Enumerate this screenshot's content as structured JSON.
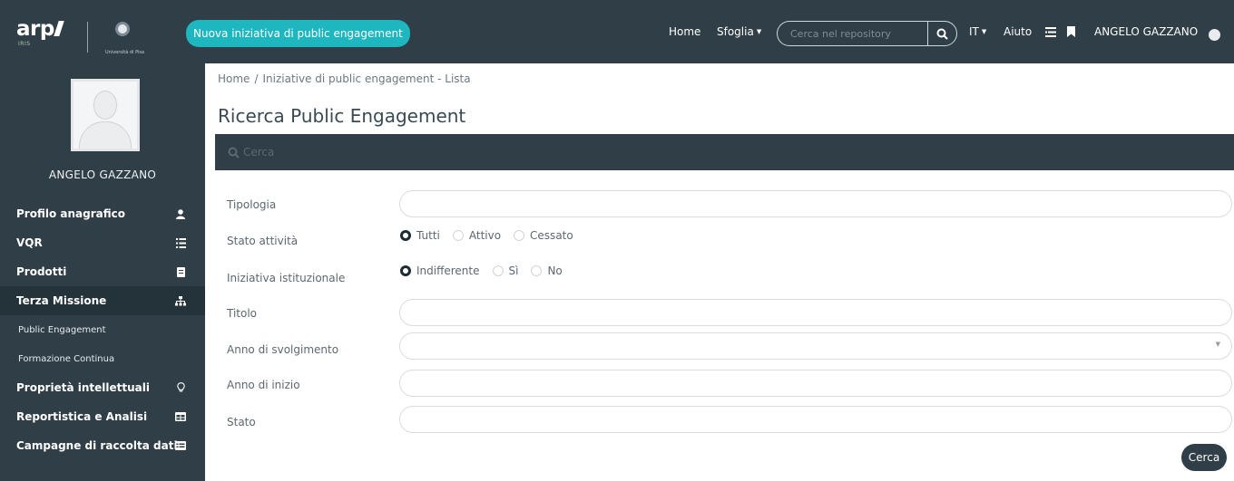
{
  "header": {
    "logo_text": "arp",
    "logo_sub": "IRIS",
    "university_name": "Università di Pisa",
    "new_initiative_label": "Nuova iniziativa di public engagement",
    "home_label": "Home",
    "browse_label": "Sfoglia",
    "search_placeholder": "Cerca nel repository",
    "language_label": "IT",
    "help_label": "Aiuto",
    "user_label": "ANGELO GAZZANO"
  },
  "sidebar": {
    "user_name": "ANGELO GAZZANO",
    "items": [
      {
        "label": "Profilo anagrafico",
        "icon": "user-icon"
      },
      {
        "label": "VQR",
        "icon": "list-ordered-icon"
      },
      {
        "label": "Prodotti",
        "icon": "book-icon"
      },
      {
        "label": "Terza Missione",
        "icon": "sitemap-icon",
        "active": true
      },
      {
        "label": "Proprietà intellettuali",
        "icon": "lightbulb-icon"
      },
      {
        "label": "Reportistica e Analisi",
        "icon": "table-icon"
      },
      {
        "label": "Campagne di raccolta dati",
        "icon": "list-table-icon"
      }
    ],
    "sub_items": [
      {
        "label": "Public Engagement"
      },
      {
        "label": "Formazione Continua"
      }
    ]
  },
  "main": {
    "breadcrumb": {
      "home": "Home",
      "separator": "/",
      "current": "Iniziative di public engagement - Lista"
    },
    "title": "Ricerca Public Engagement",
    "panel_title": "Cerca",
    "form": {
      "tipologia_label": "Tipologia",
      "stato_attivita_label": "Stato attività",
      "stato_attivita_options": [
        "Tutti",
        "Attivo",
        "Cessato"
      ],
      "stato_attivita_selected": "Tutti",
      "iniziativa_label": "Iniziativa istituzionale",
      "iniziativa_options": [
        "Indifferente",
        "Sì",
        "No"
      ],
      "iniziativa_selected": "Indifferente",
      "titolo_label": "Titolo",
      "anno_svolgimento_label": "Anno di svolgimento",
      "anno_inizio_label": "Anno di inizio",
      "stato_label": "Stato",
      "submit_label": "Cerca"
    }
  },
  "colors": {
    "topbar": "#2f3e47",
    "accent": "#1eb7c0",
    "sidebar_active": "#24323a"
  }
}
